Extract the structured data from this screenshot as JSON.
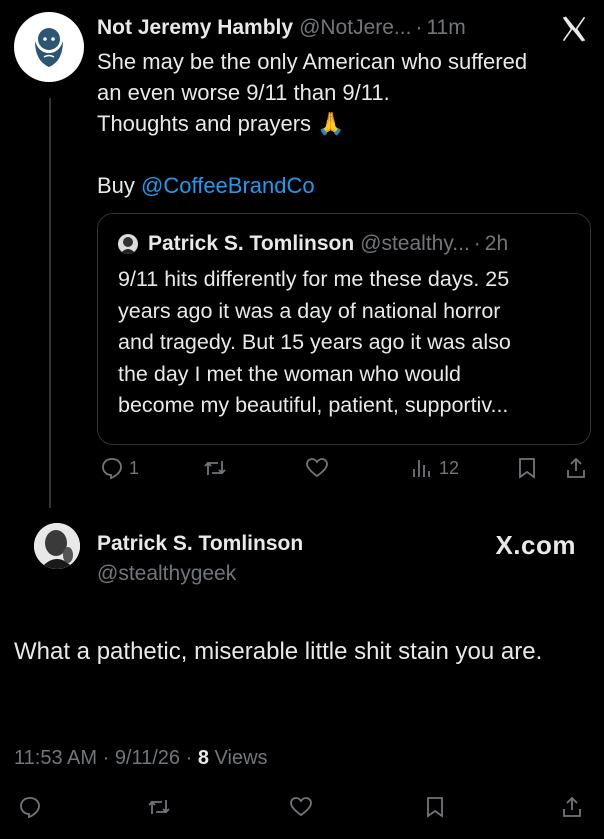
{
  "tweet1": {
    "name": "Not Jeremy Hambly",
    "handle": "@NotJere...",
    "dot": "·",
    "time": "11m",
    "lines": [
      "She may be the only American who suffered",
      "an even worse 9/11 than 9/11.",
      "Thoughts and prayers 🙏"
    ],
    "buy_prefix": "Buy ",
    "mention": "@CoffeeBrandCo",
    "quote": {
      "name": "Patrick S. Tomlinson",
      "handle": "@stealthy...",
      "dot": "·",
      "time": "2h",
      "lines": [
        "9/11 hits differently for me these days. 25",
        "years ago it was a day of national horror",
        "and tragedy. But 15 years ago it was also",
        "the day I met the woman who would",
        "become my beautiful, patient, supportiv..."
      ]
    },
    "actions": {
      "reply_count": "1",
      "views_count": "12"
    }
  },
  "tweet2": {
    "name": "Patrick S. Tomlinson",
    "handle": "@stealthygeek",
    "brand": "X.com",
    "body": "What a pathetic, miserable little shit stain you are.",
    "time": "11:53 AM",
    "sep1": " · ",
    "date": "9/11/26",
    "sep2": " · ",
    "views_count": "8",
    "views_label": " Views"
  },
  "colors": {
    "background": "#000000",
    "text": "#e7e9ea",
    "muted": "#71767b",
    "link": "#1d9bf0",
    "border": "#2f3336"
  }
}
